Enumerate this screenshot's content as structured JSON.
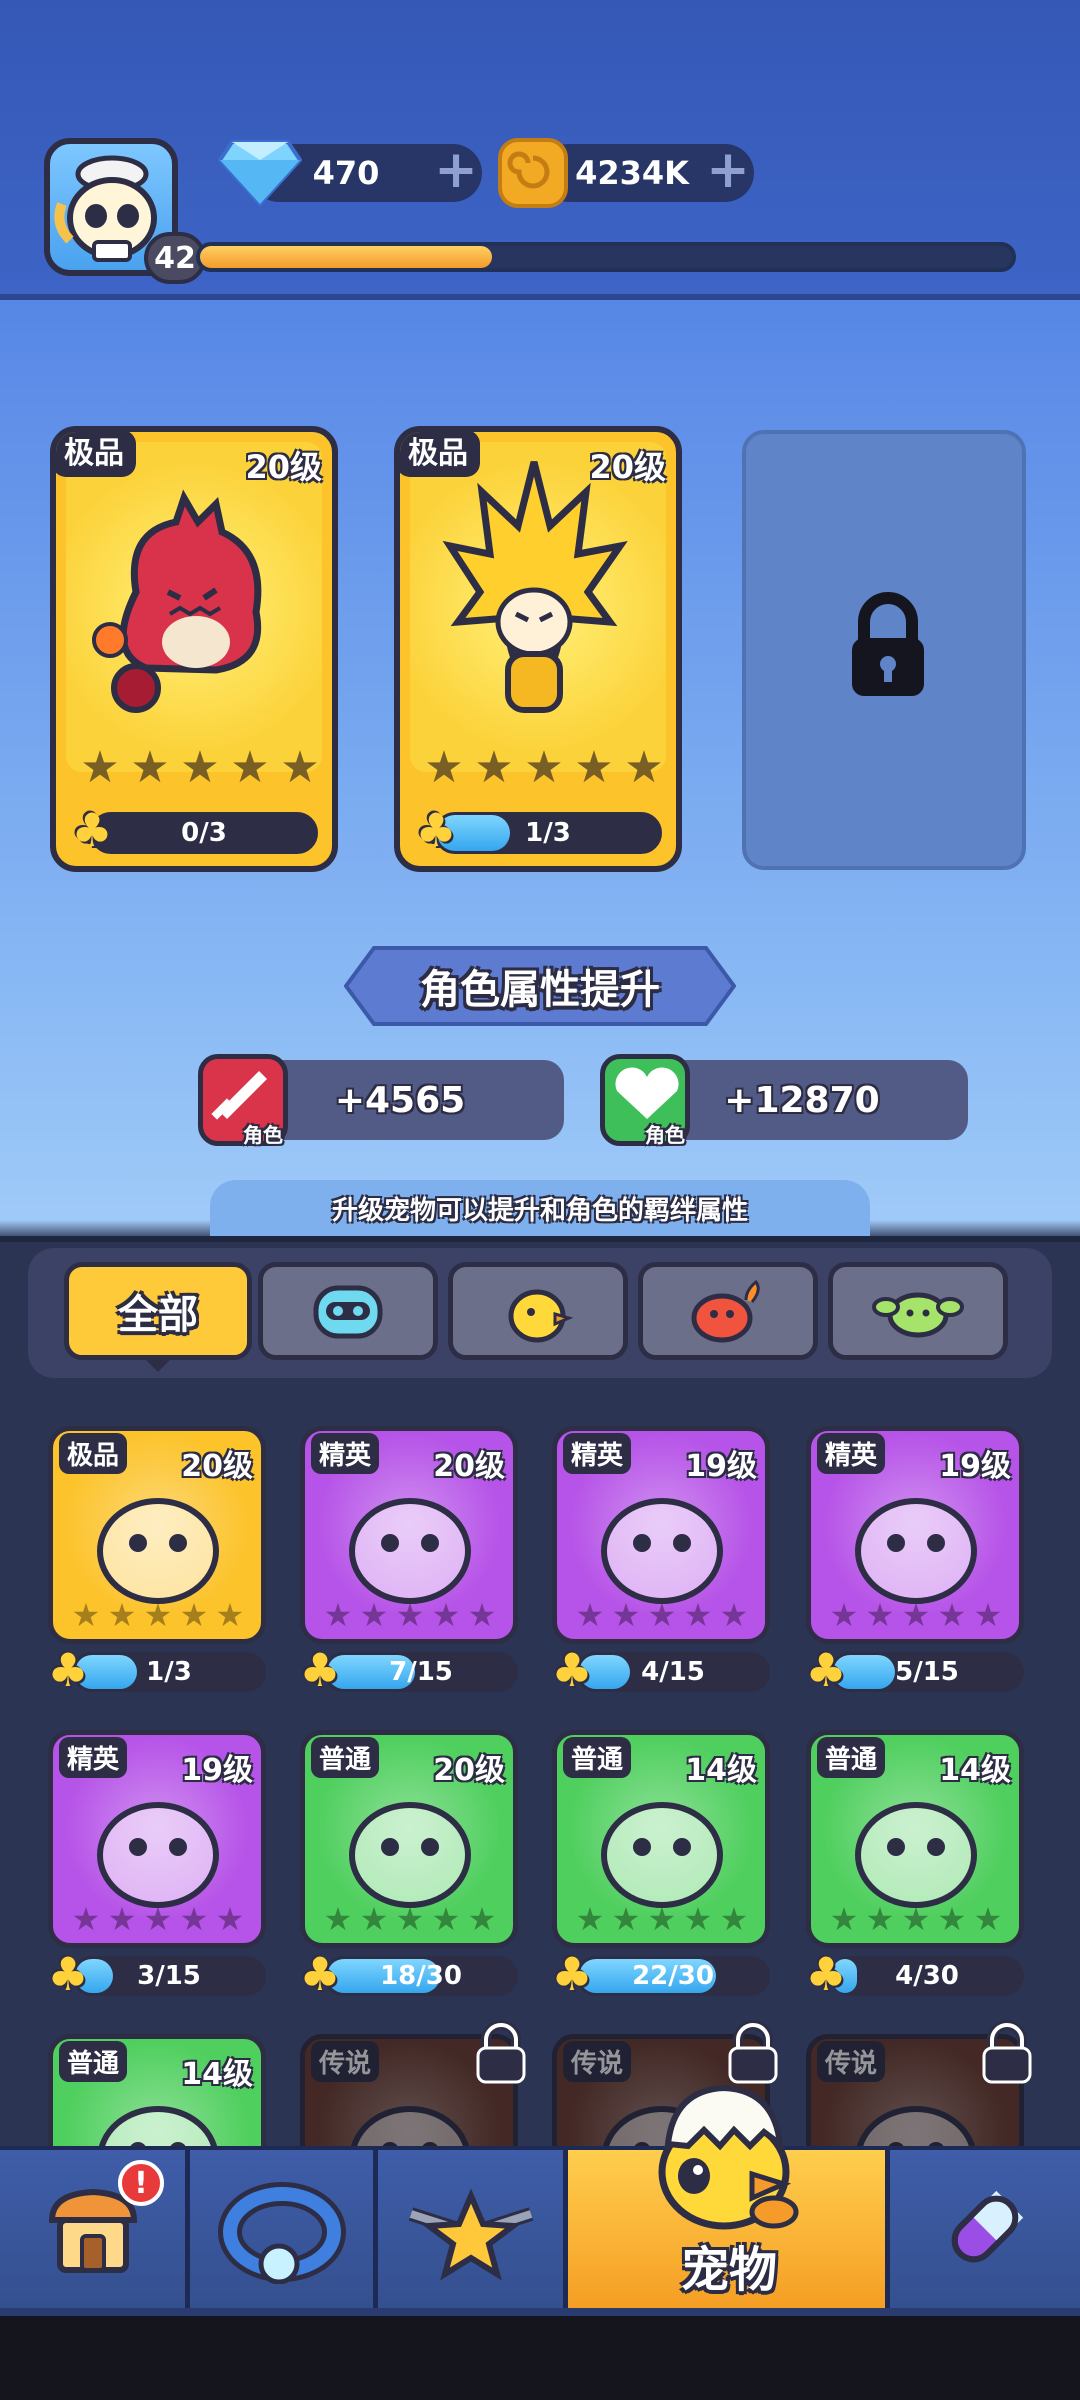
{
  "header": {
    "player_level": "42",
    "xp_progress": 0.36,
    "gems": "470",
    "coins": "4234K"
  },
  "hero_slots": [
    {
      "rarity": "极品",
      "level": "20级",
      "progress": "0/3",
      "fill": 0.0
    },
    {
      "rarity": "极品",
      "level": "20级",
      "progress": "1/3",
      "fill": 0.33
    },
    {
      "locked": true
    }
  ],
  "attribute_section": {
    "title": "角色属性提升",
    "attack_bonus": "+4565",
    "hp_bonus": "+12870",
    "badge_label": "角色",
    "hint": "升级宠物可以提升和角色的羁绊属性"
  },
  "filter_tabs": {
    "all_label": "全部",
    "tabs": [
      "all",
      "robot",
      "chick",
      "fire",
      "plant"
    ]
  },
  "pets": [
    {
      "rarity": "极品",
      "level": "20级",
      "progress": "1/3",
      "fill": 0.33,
      "color": "#fcc32b"
    },
    {
      "rarity": "精英",
      "level": "20级",
      "progress": "7/15",
      "fill": 0.47,
      "color": "#b653e8"
    },
    {
      "rarity": "精英",
      "level": "19级",
      "progress": "4/15",
      "fill": 0.27,
      "color": "#b653e8"
    },
    {
      "rarity": "精英",
      "level": "19级",
      "progress": "5/15",
      "fill": 0.33,
      "color": "#b653e8"
    },
    {
      "rarity": "精英",
      "level": "19级",
      "progress": "3/15",
      "fill": 0.2,
      "color": "#b653e8"
    },
    {
      "rarity": "普通",
      "level": "20级",
      "progress": "18/30",
      "fill": 0.6,
      "color": "#4fcf5e"
    },
    {
      "rarity": "普通",
      "level": "14级",
      "progress": "22/30",
      "fill": 0.73,
      "color": "#4fcf5e"
    },
    {
      "rarity": "普通",
      "level": "14级",
      "progress": "4/30",
      "fill": 0.13,
      "color": "#4fcf5e"
    },
    {
      "rarity": "普通",
      "level": "14级",
      "color": "#4fcf5e"
    },
    {
      "rarity": "传说",
      "locked": true,
      "color": "#6a3a2a"
    },
    {
      "rarity": "传说",
      "locked": true,
      "color": "#6a3a2a"
    },
    {
      "rarity": "传说",
      "locked": true,
      "color": "#6a3a2a"
    }
  ],
  "bottom_nav": {
    "active_label": "宠物",
    "items": [
      "shop",
      "equipment",
      "hero",
      "pet",
      "skills"
    ]
  }
}
